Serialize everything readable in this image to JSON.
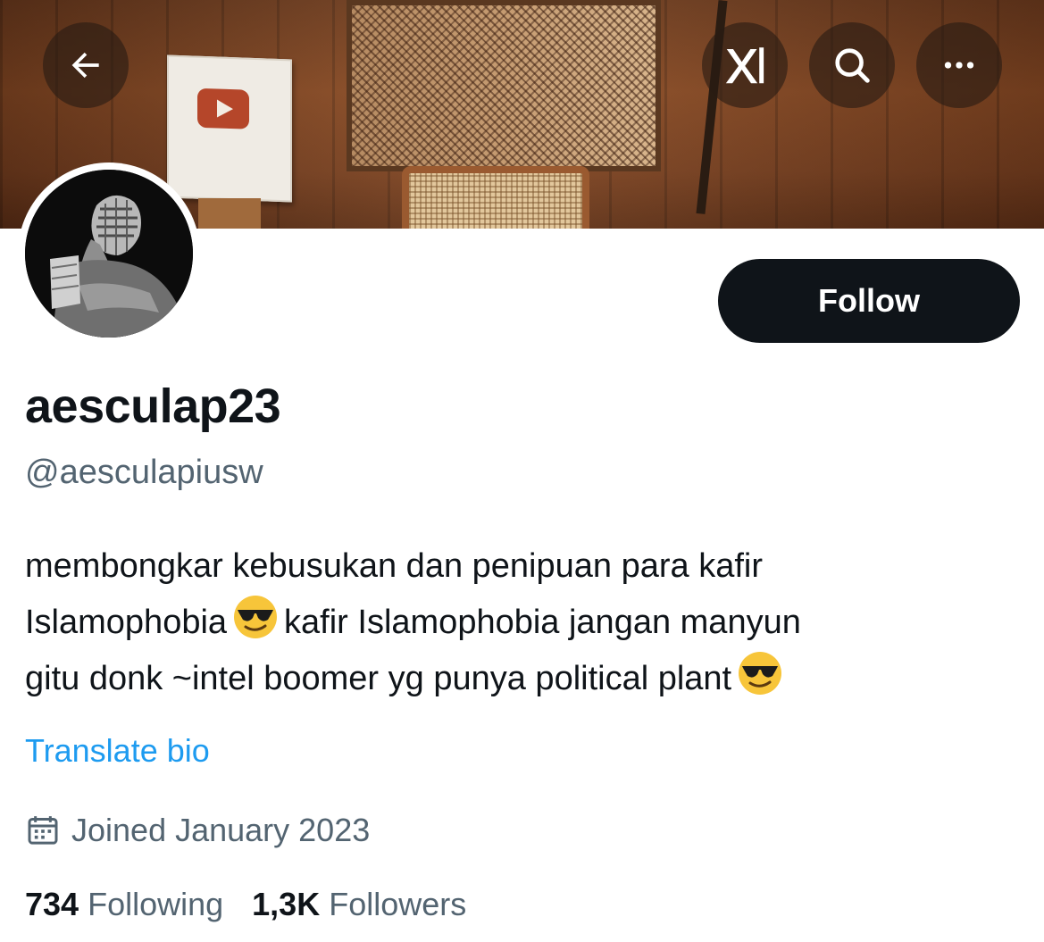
{
  "header": {
    "back_icon": "arrow-left-icon",
    "grok_icon": "grok-icon",
    "search_icon": "search-icon",
    "more_icon": "more-horizontal-icon"
  },
  "profile": {
    "display_name": "aesculap23",
    "handle": "@aesculapiusw",
    "follow_label": "Follow",
    "bio_lines": [
      [
        "membongkar kebusukan dan penipuan para kafir"
      ],
      [
        "Islamophobia",
        "😎",
        "kafir Islamophobia jangan manyun"
      ],
      [
        "gitu donk ~intel boomer yg punya political plant",
        "😎"
      ]
    ],
    "bio": {
      "line1": "membongkar kebusukan dan penipuan para kafir",
      "line2a": "Islamophobia",
      "line2b": "kafir Islamophobia jangan manyun",
      "line3a": "gitu donk ~intel boomer yg punya political plant"
    },
    "translate_label": "Translate bio",
    "joined_text": "Joined January 2023",
    "calendar_icon": "calendar-icon",
    "stats": {
      "following_count": "734",
      "following_label": "Following",
      "followers_count": "1,3K",
      "followers_label": "Followers"
    }
  },
  "colors": {
    "text_primary": "#0f1419",
    "text_secondary": "#536471",
    "link": "#1d9bf0",
    "button_bg": "#0f1419",
    "button_text": "#ffffff"
  }
}
